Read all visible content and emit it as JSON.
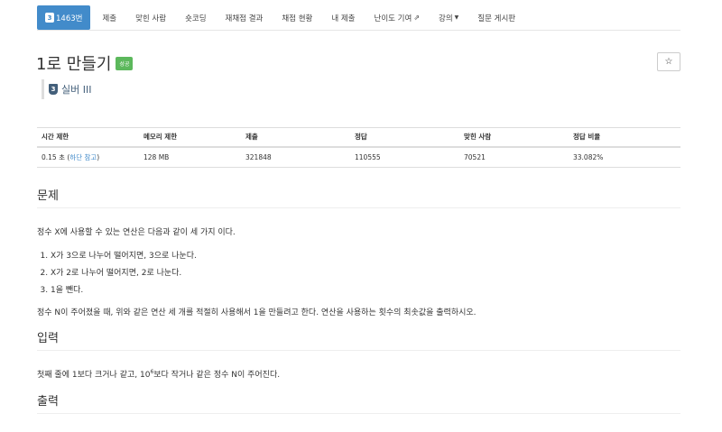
{
  "nav": {
    "tabs": [
      {
        "badge": "3",
        "label": "1463번",
        "active": true
      },
      {
        "label": "제출"
      },
      {
        "label": "맞힌 사람"
      },
      {
        "label": "숏코딩"
      },
      {
        "label": "재채점 결과"
      },
      {
        "label": "채점 현황"
      },
      {
        "label": "내 제출"
      },
      {
        "label": "난이도 기여"
      },
      {
        "label": "강의"
      },
      {
        "label": "질문 게시판"
      }
    ]
  },
  "problem": {
    "title": "1로 만들기",
    "status_badge": "성공",
    "star_icon": "☆",
    "tier_num": "3",
    "tier_label": "실버 III"
  },
  "info_table": {
    "headers": [
      "시간 제한",
      "메모리 제한",
      "제출",
      "정답",
      "맞힌 사람",
      "정답 비율"
    ],
    "time_limit": "0.15 초 (",
    "time_note_link": "하단 참고",
    "time_limit_end": ")",
    "memory_limit": "128 MB",
    "submissions": "321848",
    "accepted": "110555",
    "solvers": "70521",
    "ratio": "33.082%"
  },
  "sections": {
    "description_title": "문제",
    "description_intro": "정수 X에 사용할 수 있는 연산은 다음과 같이 세 가지 이다.",
    "operations": [
      "X가 3으로 나누어 떨어지면, 3으로 나눈다.",
      "X가 2로 나누어 떨어지면, 2로 나눈다.",
      "1을 뺀다."
    ],
    "description_outro": "정수 N이 주어졌을 때, 위와 같은 연산 세 개를 적절히 사용해서 1을 만들려고 한다. 연산을 사용하는 횟수의 최솟값을 출력하시오.",
    "input_title": "입력",
    "input_text_a": "첫째 줄에 1보다 크거나 같고, 10",
    "input_sup": "6",
    "input_text_b": "보다 작거나 같은 정수 N이 주어진다.",
    "output_title": "출력"
  }
}
